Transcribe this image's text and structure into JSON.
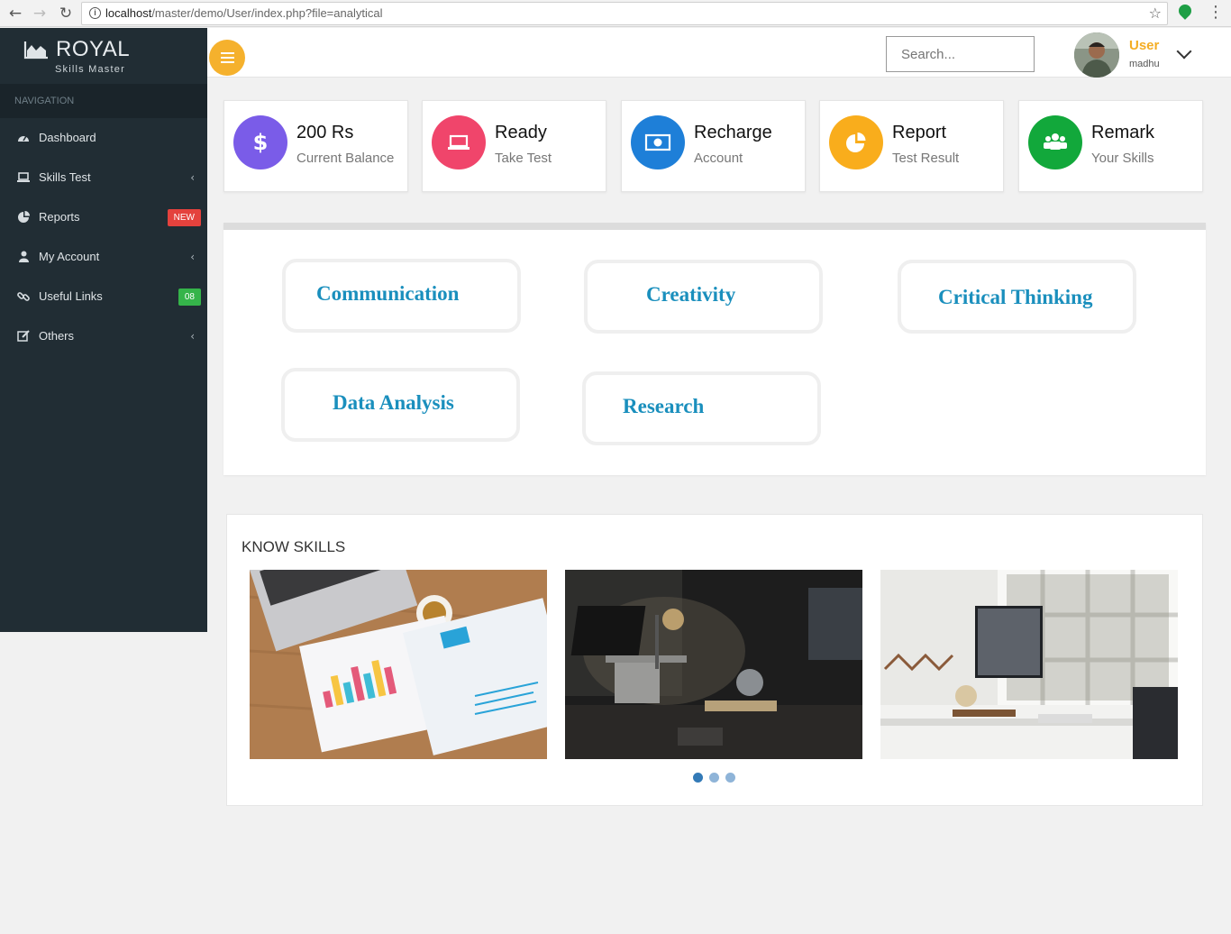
{
  "browser": {
    "url_host": "localhost",
    "url_path": "/master/demo/User/index.php?file=analytical"
  },
  "sidebar": {
    "logo_title": "ROYAL",
    "logo_subtitle": "Skills Master",
    "nav_header": "NAVIGATION",
    "items": [
      {
        "label": "Dashboard",
        "icon": "dashboard-icon"
      },
      {
        "label": "Skills Test",
        "icon": "laptop-icon",
        "has_submenu": true
      },
      {
        "label": "Reports",
        "icon": "pie-chart-icon",
        "badge": "NEW"
      },
      {
        "label": "My Account",
        "icon": "user-icon",
        "has_submenu": true
      },
      {
        "label": "Useful Links",
        "icon": "link-icon",
        "badge": "08"
      },
      {
        "label": "Others",
        "icon": "edit-icon",
        "has_submenu": true
      }
    ]
  },
  "header": {
    "search_placeholder": "Search...",
    "user_name": "User",
    "user_subtitle": "madhu"
  },
  "stats": [
    {
      "value": "200 Rs",
      "label": "Current Balance",
      "color": "#7a5ce8",
      "icon": "dollar-icon"
    },
    {
      "value": "Ready",
      "label": "Take Test",
      "color": "#f0456b",
      "icon": "laptop-icon"
    },
    {
      "value": "Recharge",
      "label": "Account",
      "color": "#1e7fd8",
      "icon": "money-icon"
    },
    {
      "value": "Report",
      "label": "Test Result",
      "color": "#f9ad1c",
      "icon": "pie-chart-icon"
    },
    {
      "value": "Remark",
      "label": "Your Skills",
      "color": "#12a83b",
      "icon": "users-icon"
    }
  ],
  "skills": [
    "Communication",
    "Creativity",
    "Critical Thinking",
    "Data Analysis",
    "Research"
  ],
  "know_skills": {
    "title": "KNOW SKILLS",
    "slide_count": 3,
    "active_slide": 1
  },
  "colors": {
    "sidebar_bg": "#212d34",
    "accent": "#f5b12d",
    "skill_text": "#1a8fbd"
  }
}
